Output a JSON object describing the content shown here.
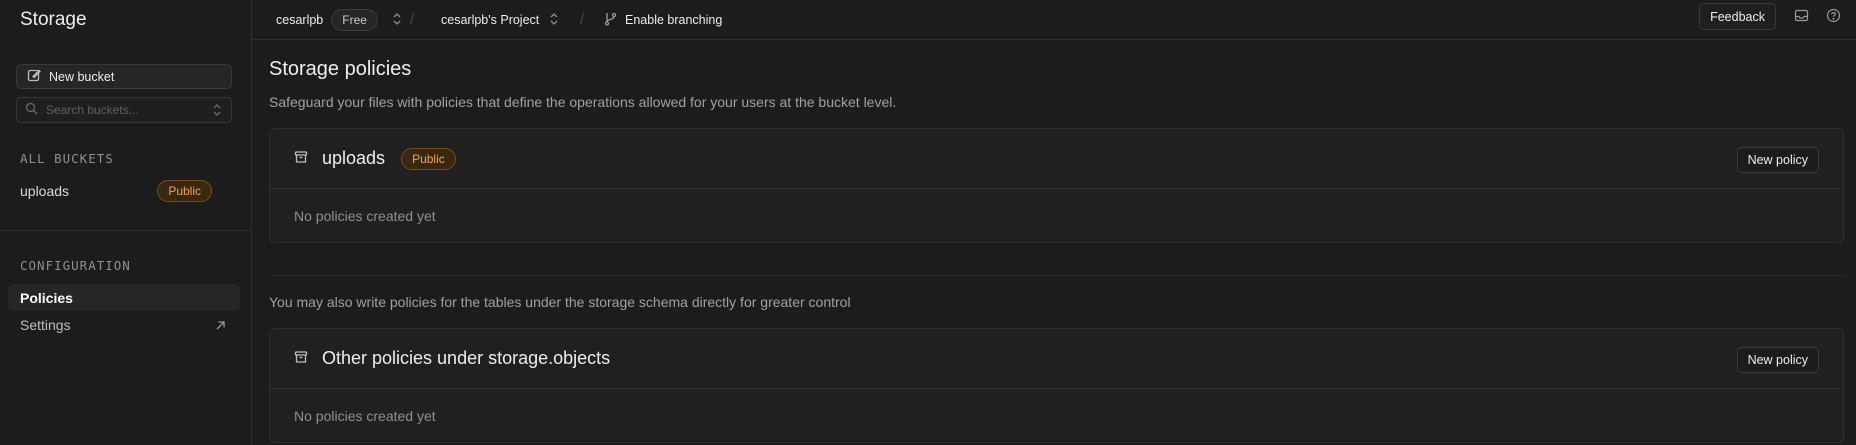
{
  "sidebar": {
    "title": "Storage",
    "new_bucket_label": "New bucket",
    "search_placeholder": "Search buckets...",
    "all_buckets_label": "ALL BUCKETS",
    "buckets": [
      {
        "name": "uploads",
        "badge": "Public"
      }
    ],
    "configuration_label": "CONFIGURATION",
    "nav": [
      {
        "label": "Policies",
        "active": true
      },
      {
        "label": "Settings",
        "active": false
      }
    ]
  },
  "topbar": {
    "org": "cesarlpb",
    "plan": "Free",
    "project": "cesarlpb's Project",
    "branching": "Enable branching",
    "feedback": "Feedback"
  },
  "main": {
    "title": "Storage policies",
    "description": "Safeguard your files with policies that define the operations allowed for your users at the bucket level.",
    "cards": [
      {
        "title": "uploads",
        "badge": "Public",
        "new_policy": "New policy",
        "empty": "No policies created yet"
      },
      {
        "title": "Other policies under storage.objects",
        "new_policy": "New policy",
        "empty": "No policies created yet"
      }
    ],
    "extra_description": "You may also write policies for the tables under the storage schema directly for greater control"
  },
  "colors": {
    "background": "#1c1c1c",
    "public_badge_text": "#f0a450"
  }
}
